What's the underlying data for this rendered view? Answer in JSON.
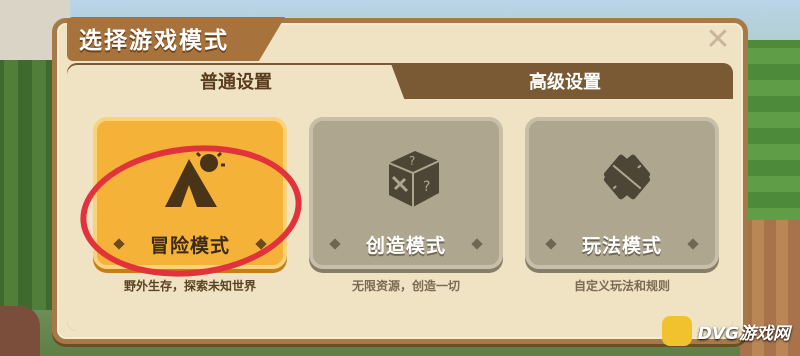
{
  "dialog": {
    "title": "选择游戏模式",
    "close_label": "✕"
  },
  "tabs": [
    {
      "label": "普通设置",
      "active": true
    },
    {
      "label": "高级设置",
      "active": false
    }
  ],
  "modes": [
    {
      "label": "冒险模式",
      "description": "野外生存，探索未知世界",
      "icon": "tent-sun-icon",
      "selected": true
    },
    {
      "label": "创造模式",
      "description": "无限资源，创造一切",
      "icon": "mystery-box-pickaxe-icon",
      "selected": false
    },
    {
      "label": "玩法模式",
      "description": "自定义玩法和规则",
      "icon": "crossed-flags-icon",
      "selected": false
    }
  ],
  "watermark": {
    "text": "DVG游戏网"
  },
  "colors": {
    "panel_bg": "#efe3c4",
    "accent_orange": "#f5b238",
    "title_brown": "#a8723d",
    "highlight_red": "#e2323c"
  }
}
